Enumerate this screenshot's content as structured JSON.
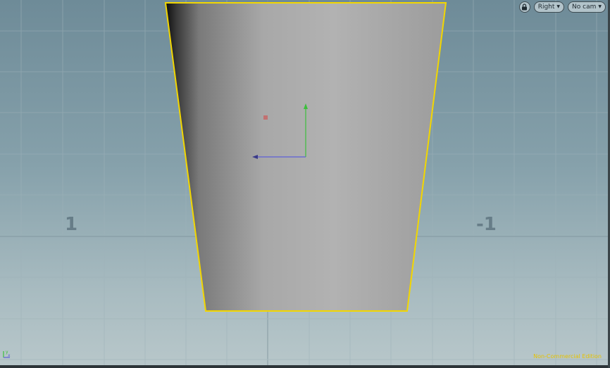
{
  "viewport": {
    "grid_labels": {
      "left": "1",
      "right": "-1"
    },
    "view_menu": {
      "label": "Right"
    },
    "camera_menu": {
      "label": "No cam"
    },
    "watermark": "Non-Commercial Edition",
    "icons": {
      "lock": "lock-icon",
      "dropdown": "chevron-down-icon",
      "axis": "axis-indicator-icon"
    },
    "colors": {
      "selection_outline": "#f2d600",
      "handle_y": "#3cbf3c",
      "handle_z": "#5d5fd8",
      "pivot": "#c46a6a",
      "watermark": "#e6c200"
    }
  }
}
